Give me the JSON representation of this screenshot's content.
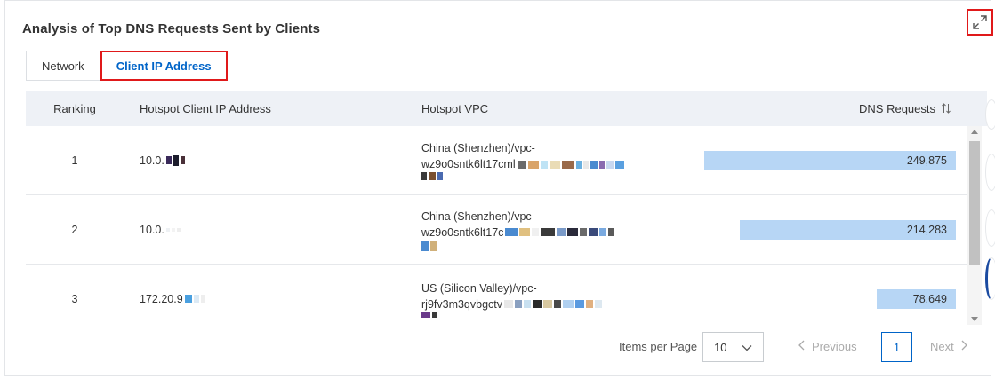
{
  "panel": {
    "title": "Analysis of Top DNS Requests Sent by Clients",
    "expand_icon": "expand-arrows-icon"
  },
  "tabs": [
    {
      "label": "Network",
      "active": false
    },
    {
      "label": "Client IP Address",
      "active": true
    }
  ],
  "table": {
    "headers": {
      "ranking": "Ranking",
      "ip": "Hotspot Client IP Address",
      "vpc": "Hotspot VPC",
      "dns": "DNS Requests"
    },
    "max_requests": 249875,
    "rows": [
      {
        "ranking": "1",
        "ip": "10.0.",
        "vpc_line1": "China (Shenzhen)/vpc-",
        "vpc_line2": "wz9o0sntk6lt17cml",
        "dns": "249,875",
        "dns_value": 249875
      },
      {
        "ranking": "2",
        "ip": "10.0.",
        "vpc_line1": "China (Shenzhen)/vpc-",
        "vpc_line2": "wz9o0sntk6lt17c",
        "dns": "214,283",
        "dns_value": 214283
      },
      {
        "ranking": "3",
        "ip": "172.20.9",
        "vpc_line1": "US (Silicon Valley)/vpc-",
        "vpc_line2": "rj9fv3m3qvbgctv",
        "dns": "78,649",
        "dns_value": 78649
      }
    ]
  },
  "pagination": {
    "items_per_page_label": "Items per Page",
    "items_per_page_value": "10",
    "previous_label": "Previous",
    "current_page": "1",
    "next_label": "Next"
  },
  "colors": {
    "accent": "#0064c8",
    "highlight": "#e0191a",
    "bar": "#b7d6f5",
    "header_bg": "#eef1f6"
  }
}
